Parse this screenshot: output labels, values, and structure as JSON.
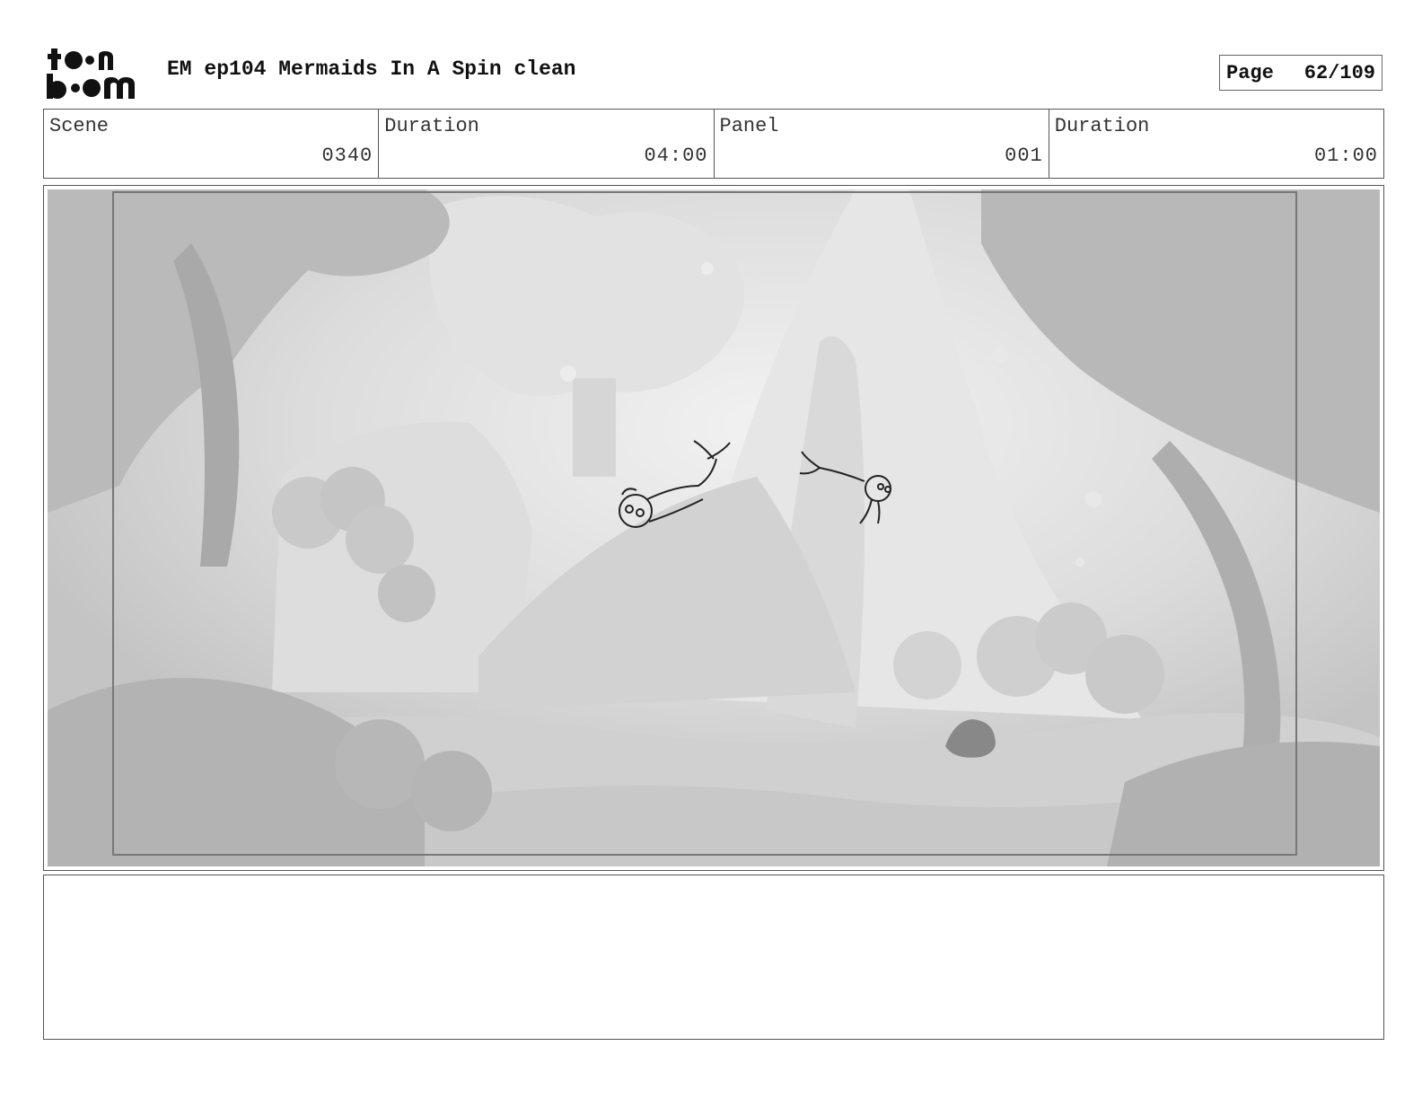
{
  "header": {
    "logo_icon": "toonboom-logo",
    "title": "EM ep104 Mermaids In A Spin clean",
    "page_label": "Page",
    "page_number": "62/109"
  },
  "info": {
    "scene_label": "Scene",
    "scene_value": "0340",
    "scene_duration_label": "Duration",
    "scene_duration_value": "04:00",
    "panel_label": "Panel",
    "panel_value": "001",
    "panel_duration_label": "Duration",
    "panel_duration_value": "01:00"
  },
  "panel": {
    "image_icon": "underwater-reef-scene-with-two-mermaids"
  },
  "colors": {
    "border": "#555555",
    "background": "#ffffff"
  }
}
